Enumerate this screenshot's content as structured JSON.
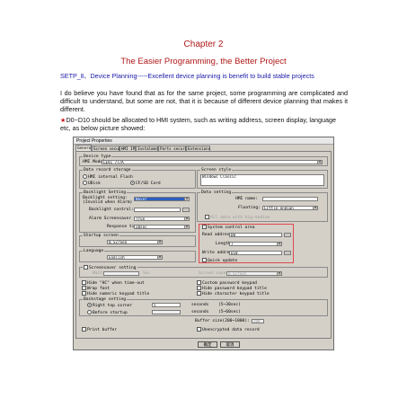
{
  "doc": {
    "chapter": "Chapter 2",
    "subtitle": "The Easier Programming, the Better Project",
    "setp": "SETP_Ⅱ、Device Planning-----Excellent device planning is benefit to build stable projects",
    "para": "I do believe you have found that as for the same project, some programming are complicated and difficult to understand, but some are not, that it is because of different device planning that makes it different.",
    "note_star": "★",
    "note": "D0~D10 should be allocated to HMI system, such as writing address, screen display, language etc, as below picture showed:"
  },
  "dialog": {
    "title": "Project Properties",
    "tabs": [
      "General",
      "Screen security",
      "HMI IP",
      "Instalment",
      "Parts security",
      "Extensions"
    ],
    "device_type": {
      "label": "Device type",
      "model_label": "HMI Model",
      "model_value": "LEVI 777A"
    },
    "data_record": {
      "label": "Data record storage",
      "opt1": "HMI internal Flash",
      "opt2": "UDisk",
      "opt3": "CF/SD Card"
    },
    "screen_style": {
      "label": "Screen style",
      "value": "Windows Classic"
    },
    "backlight": {
      "label": "Backlight Setting",
      "setting_label": "Backlight setting:",
      "setting_note": "(Invalid when Alarm)",
      "setting_value": "Never",
      "control_label": "Backlight control:",
      "alarm_label": "Alarm Screensaver",
      "alarm_value": "True",
      "response_label": "Response time:",
      "response_value": "20sec"
    },
    "data_setting": {
      "label": "Data setting",
      "hmi_name_label": "HMI name:",
      "floating_label": "Floating:",
      "floating_value": "Little-endian",
      "bigendian_label": "All data with big-endian"
    },
    "system_control": {
      "checkbox_label": "System control area",
      "read_label": "Read address:",
      "read_value": "D0",
      "length_label": "Length:",
      "length_value": "7",
      "write_label": "Write address:",
      "write_value": "D10",
      "quick_label": "Quick update"
    },
    "startup": {
      "label": "Startup screen",
      "value": "0.Screen"
    },
    "language": {
      "label": "Language",
      "value": "English"
    },
    "screensaver": {
      "checkbox_label": "Screensaver setting",
      "wait_label": "Wait",
      "sec_label": "Sec",
      "screen_label": "Screen saver",
      "screen_value": "0.Screen"
    },
    "options_left": [
      "Hide \"HC\" when time-out",
      "Wrap font",
      "Hide numeric keypad title"
    ],
    "options_right": [
      "Custom password keypad",
      "Hide password keypad title",
      "Hide character keypad title"
    ],
    "backstage": {
      "label": "Backstage setting",
      "right_top_label": "Right top corner",
      "right_top_value": "5",
      "before_label": "Before startup",
      "seconds_label": "seconds",
      "range1": "(5~30sec)",
      "range2": "(5~60sec)"
    },
    "buffer": {
      "label": "Buffer size(200~1000):",
      "value": "200"
    },
    "print_label": "Print buffer",
    "unencrypted_label": "Unencrypted data record",
    "buttons": {
      "ok": "确定",
      "cancel": "取消"
    },
    "browse": "..."
  }
}
